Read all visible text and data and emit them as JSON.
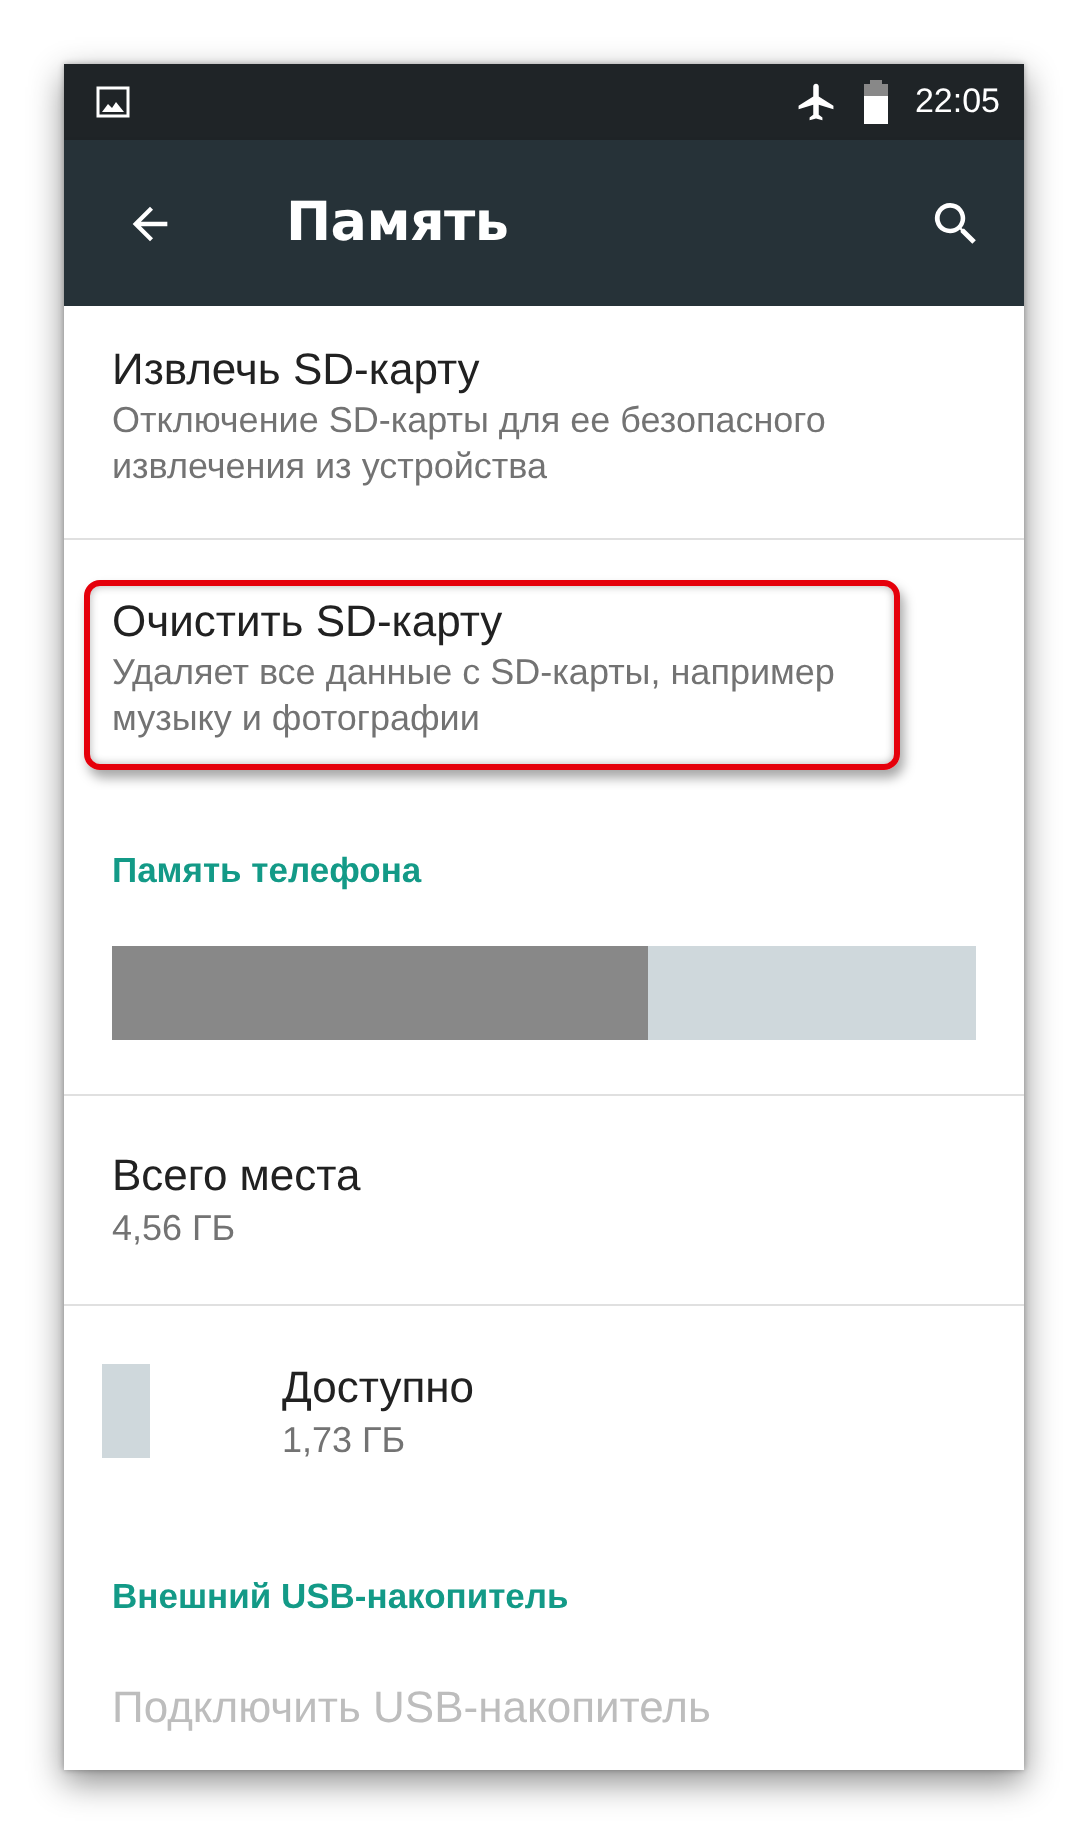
{
  "status_bar": {
    "time": "22:05"
  },
  "toolbar": {
    "title": "Память"
  },
  "items": [
    {
      "kind": "preference",
      "title": "Извлечь SD-карту",
      "summary": "Отключение SD-карты для ее безопасного извлечения из устройства",
      "disabled": false
    },
    {
      "kind": "preference",
      "title": "Очистить SD-карту",
      "summary": "Удаляет все данные с SD-карты, например музыку и фотографии",
      "highlighted": true,
      "disabled": false
    },
    {
      "kind": "category",
      "title": "Память телефона"
    },
    {
      "kind": "storage_bar",
      "level": 0.62
    },
    {
      "kind": "storage_stat",
      "title": "Всего места",
      "value": "4,56 ГБ"
    },
    {
      "kind": "storage_stat",
      "title": "Доступно",
      "value": "1,73 ГБ",
      "color": "#cfd8dc"
    },
    {
      "kind": "category",
      "title": "Внешний USB-накопитель"
    },
    {
      "kind": "preference",
      "title": "Подключить USB-накопитель",
      "disabled": true
    }
  ]
}
